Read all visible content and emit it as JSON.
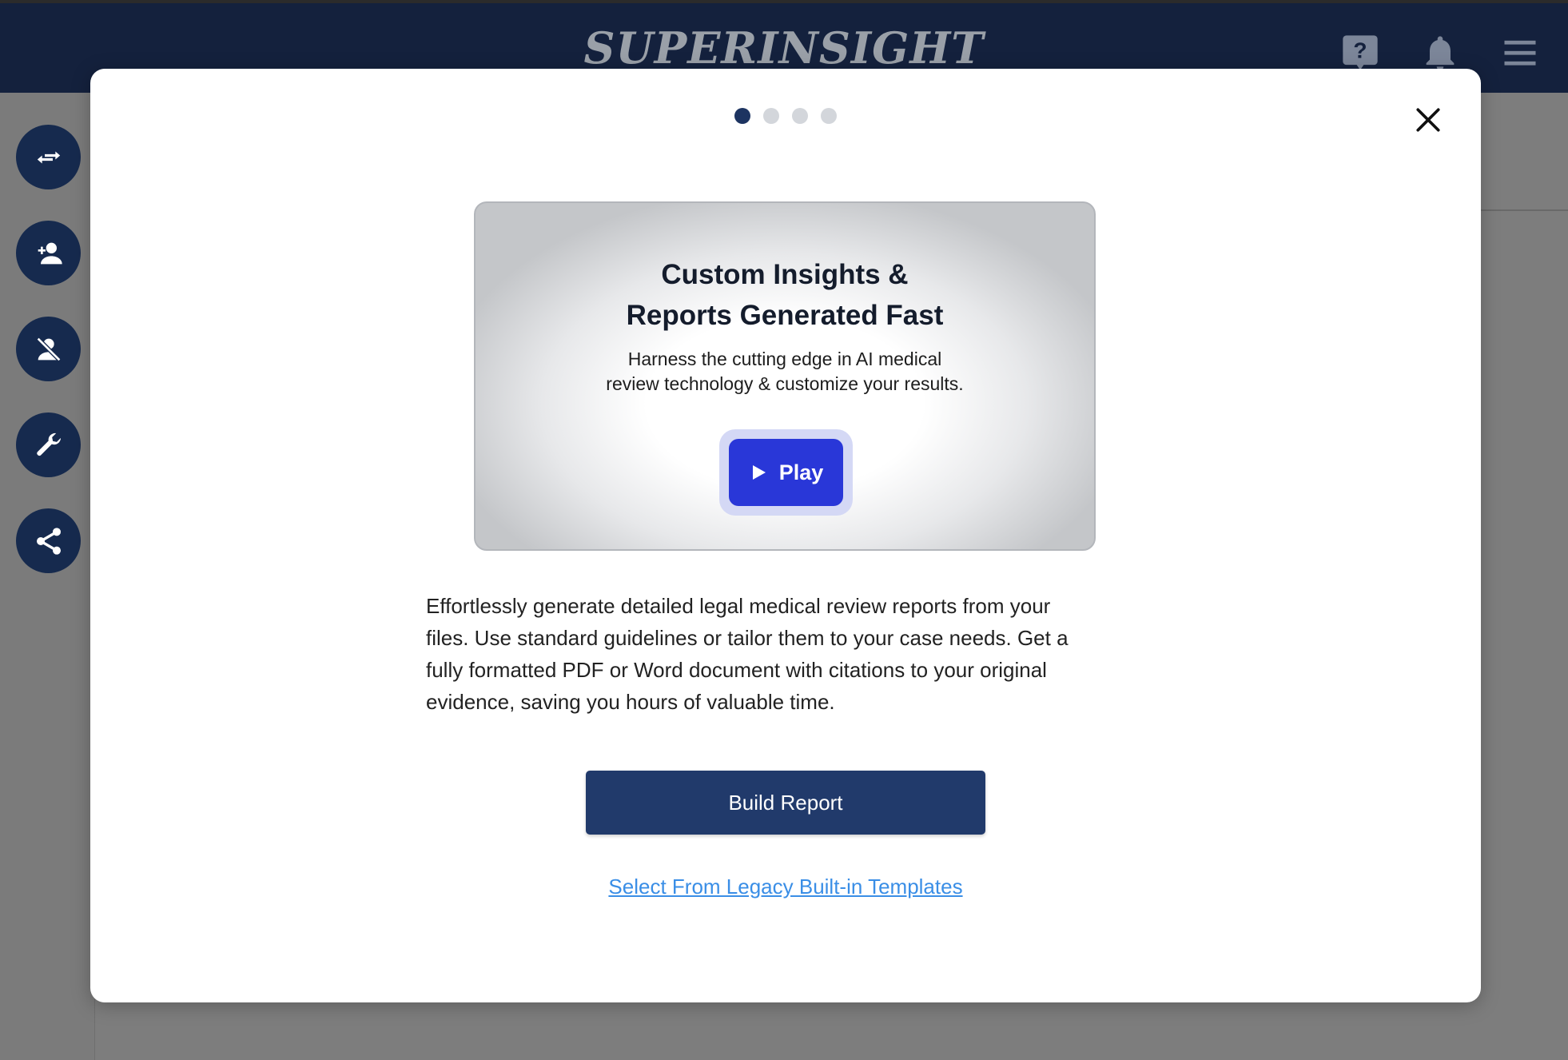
{
  "app": {
    "brand": "SUPERINSIGHT",
    "header_icons": [
      "help-icon",
      "bell-icon",
      "menu-icon"
    ],
    "rail_icons": [
      "swap-arrows-icon",
      "add-person-icon",
      "remove-person-icon",
      "wrench-icon",
      "share-icon"
    ]
  },
  "modal": {
    "carousel": {
      "total": 4,
      "active": 1
    },
    "video": {
      "title": "Custom Insights &\nReports Generated Fast",
      "subtitle": "Harness the cutting edge in AI medical\nreview technology & customize your results.",
      "play_label": "Play"
    },
    "description": "Effortlessly generate detailed legal medical review reports from your\nfiles. Use standard guidelines or tailor them to your case needs. Get a\nfully formatted PDF or Word document with citations to your original\nevidence, saving you hours of valuable time.",
    "primary_button": "Build Report",
    "secondary_link": "Select From Legacy Built-in Templates"
  },
  "colors": {
    "header_bg": "#14213d",
    "rail_button": "#162a4e",
    "primary": "#213a6b",
    "play": "#2937d8",
    "link": "#3a8ee6",
    "dot_active": "#1d3461",
    "dot_inactive": "#d3d6db"
  }
}
